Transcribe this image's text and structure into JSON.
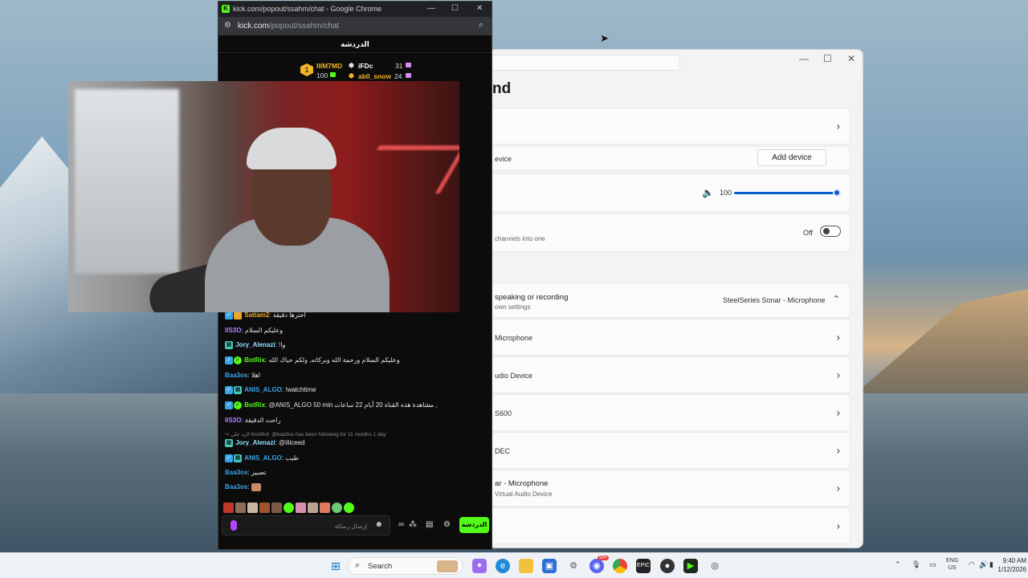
{
  "chrome": {
    "window_title": "kick.com/popout/ssahm/chat - Google Chrome",
    "url_domain": "kick.com",
    "url_path": "/popout/ssahm/chat",
    "minimize": "—",
    "maximize": "☐",
    "close": "✕"
  },
  "chat": {
    "header": "الدردشة",
    "leaderboard": {
      "rank": "1",
      "users": [
        {
          "name": "IlIM7MD",
          "value": "100",
          "color": "#f3b326"
        },
        {
          "name": "iFDc",
          "value": "31",
          "color": "#ffffff"
        },
        {
          "name": "ab0_snow",
          "value": "24",
          "color": "#f3b326"
        }
      ]
    },
    "messages": [
      {
        "user": "Sattam2",
        "text": "اخترها دقيقة",
        "color": "#f0a52b"
      },
      {
        "user": "IlS3O",
        "text": "وعليكم السلام",
        "color": "#b184ff"
      },
      {
        "user": "Jory_Alenazi",
        "text": "!وا",
        "color": "#8ce0ff"
      },
      {
        "user": "BotRix",
        "text": "وعليكم السلام ورحمة الله وبركاته, ولكم حياك الله",
        "color": "#53fc18"
      },
      {
        "user": "Baa3os",
        "text": "اهلا",
        "color": "#3aa4e8"
      },
      {
        "user": "ANIS_ALGO",
        "text": "!watchtime",
        "color": "#3aa4e8"
      },
      {
        "user": "BotRix",
        "text": "@ANIS_ALGO 50 min مشاهدة هذه القناة 20 أيام 22 ساعات ,",
        "color": "#53fc18"
      },
      {
        "user": "IlS3O",
        "text": "راحت الدقيقة",
        "color": "#b184ff"
      },
      {
        "user": "Jory_Alenazi",
        "text": "@iliiceed",
        "color": "#8ce0ff"
      },
      {
        "user": "ANIS_ALGO",
        "text": "طيب",
        "color": "#3aa4e8"
      },
      {
        "user": "Baa3os",
        "text": "تصبير",
        "color": "#3aa4e8"
      },
      {
        "user": "Baa3os",
        "text": "",
        "color": "#3aa4e8"
      }
    ],
    "reply_note": "الرد على KickBot: @baa3os has been following for 11 months 1 day",
    "input_placeholder": "إرسال رسالة",
    "send_label": "الدردشة"
  },
  "settings": {
    "title": "nd",
    "add_device": "Add device",
    "device_label": "evice",
    "volume_value": "100",
    "mono_desc": "channels into one",
    "mono_state": "Off",
    "input_title": "speaking or recording",
    "input_sub": "own settings",
    "input_selected": "SteelSeries Sonar - Microphone",
    "devices": [
      {
        "name": "Microphone",
        "sub": ""
      },
      {
        "name": "udio Device",
        "sub": ""
      },
      {
        "name": "S600",
        "sub": ""
      },
      {
        "name": "DEC",
        "sub": ""
      },
      {
        "name": "ar - Microphone",
        "sub": "Virtual Audio Device"
      },
      {
        "name": "",
        "sub": ""
      }
    ]
  },
  "taskbar": {
    "search": "Search",
    "lang_top": "ENG",
    "lang_bottom": "US",
    "time": "9:40 AM",
    "date": "1/12/2026",
    "discord_badge": "99+"
  }
}
